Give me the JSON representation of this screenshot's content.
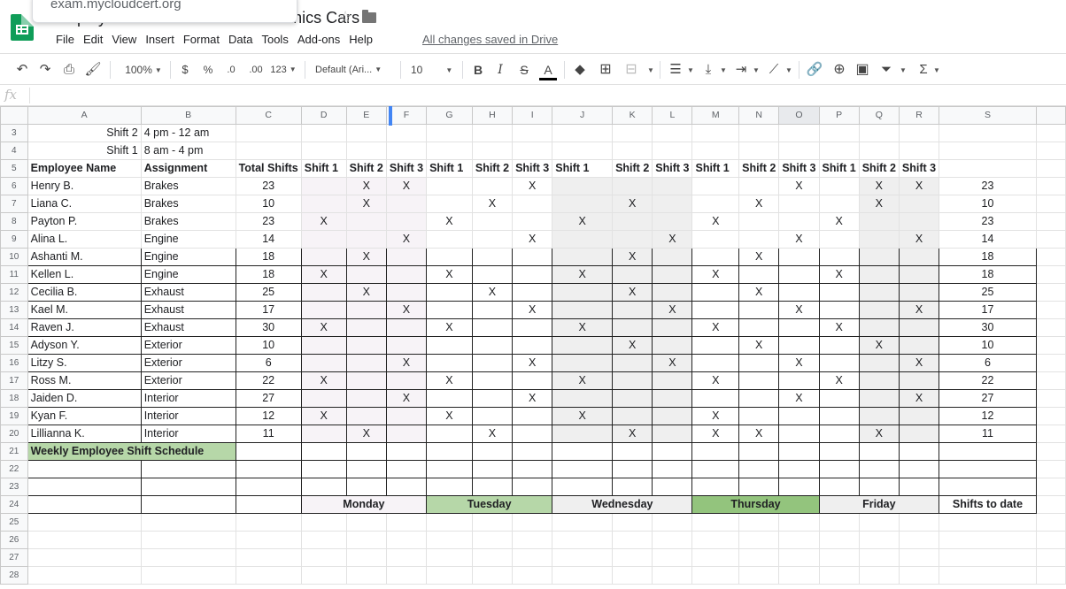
{
  "header": {
    "doc_title": "Employee Shift Schedule - Mechanics Cars",
    "url_overlay": "exam.mycloudcert.org",
    "menu": [
      "File",
      "Edit",
      "View",
      "Insert",
      "Format",
      "Data",
      "Tools",
      "Add-ons",
      "Help"
    ],
    "save_status": "All changes saved in Drive"
  },
  "toolbar": {
    "zoom": "100%",
    "currency": "$",
    "percent": "%",
    "dec_decrease": ".0",
    "dec_increase": ".00",
    "more_formats": "123",
    "font": "Default (Ari...",
    "font_size": "10",
    "bold": "B",
    "italic": "I",
    "strike": "S",
    "text_color": "A",
    "sum": "Σ"
  },
  "formula_bar": {
    "fx_label": "fx",
    "value": ""
  },
  "columns": [
    "A",
    "B",
    "C",
    "D",
    "E",
    "F",
    "G",
    "H",
    "I",
    "J",
    "K",
    "L",
    "M",
    "N",
    "O",
    "P",
    "Q",
    "R",
    "S"
  ],
  "sheet": {
    "shift2_label": "Shift 2",
    "shift2_time": "4 pm - 12 am",
    "shift1_label": "Shift 1",
    "shift1_time": "8 am - 4 pm",
    "headers": {
      "employee": "Employee Name",
      "assignment": "Assignment",
      "total": "Total Shifts",
      "shifts": [
        "Shift 1",
        "Shift 2",
        "Shift 3",
        "Shift 1",
        "Shift 2",
        "Shift 3",
        "Shift 1",
        "Shift 2",
        "Shift 3",
        "Shift 1",
        "Shift 2",
        "Shift 3",
        "Shift 1",
        "Shift 2",
        "Shift 3"
      ]
    },
    "mark": "X",
    "employees": [
      {
        "row": "6",
        "name": "Henry B.",
        "assignment": "Brakes",
        "total": "23",
        "marks": [
          0,
          1,
          1,
          0,
          0,
          1,
          0,
          0,
          0,
          0,
          0,
          1,
          0,
          1,
          1
        ],
        "to_date": "23"
      },
      {
        "row": "7",
        "name": "Liana C.",
        "assignment": "Brakes",
        "total": "10",
        "marks": [
          0,
          1,
          0,
          0,
          1,
          0,
          0,
          1,
          0,
          0,
          1,
          0,
          0,
          1,
          0
        ],
        "to_date": "10"
      },
      {
        "row": "8",
        "name": "Payton P.",
        "assignment": "Brakes",
        "total": "23",
        "marks": [
          1,
          0,
          0,
          1,
          0,
          0,
          1,
          0,
          0,
          1,
          0,
          0,
          1,
          0,
          0
        ],
        "to_date": "23"
      },
      {
        "row": "9",
        "name": "Alina L.",
        "assignment": "Engine",
        "total": "14",
        "marks": [
          0,
          0,
          1,
          0,
          0,
          1,
          0,
          0,
          1,
          0,
          0,
          1,
          0,
          0,
          1
        ],
        "to_date": "14"
      },
      {
        "row": "10",
        "name": "Ashanti M.",
        "assignment": "Engine",
        "total": "18",
        "marks": [
          0,
          1,
          0,
          0,
          0,
          0,
          0,
          1,
          0,
          0,
          1,
          0,
          0,
          0,
          0
        ],
        "to_date": "18"
      },
      {
        "row": "11",
        "name": "Kellen L.",
        "assignment": "Engine",
        "total": "18",
        "marks": [
          1,
          0,
          0,
          1,
          0,
          0,
          1,
          0,
          0,
          1,
          0,
          0,
          1,
          0,
          0
        ],
        "to_date": "18"
      },
      {
        "row": "12",
        "name": "Cecilia B.",
        "assignment": "Exhaust",
        "total": "25",
        "marks": [
          0,
          1,
          0,
          0,
          1,
          0,
          0,
          1,
          0,
          0,
          1,
          0,
          0,
          0,
          0
        ],
        "to_date": "25"
      },
      {
        "row": "13",
        "name": "Kael M.",
        "assignment": "Exhaust",
        "total": "17",
        "marks": [
          0,
          0,
          1,
          0,
          0,
          1,
          0,
          0,
          1,
          0,
          0,
          1,
          0,
          0,
          1
        ],
        "to_date": "17"
      },
      {
        "row": "14",
        "name": "Raven J.",
        "assignment": "Exhaust",
        "total": "30",
        "marks": [
          1,
          0,
          0,
          1,
          0,
          0,
          1,
          0,
          0,
          1,
          0,
          0,
          1,
          0,
          0
        ],
        "to_date": "30"
      },
      {
        "row": "15",
        "name": "Adyson Y.",
        "assignment": "Exterior",
        "total": "10",
        "marks": [
          0,
          0,
          0,
          0,
          0,
          0,
          0,
          1,
          0,
          0,
          1,
          0,
          0,
          1,
          0
        ],
        "to_date": "10"
      },
      {
        "row": "16",
        "name": "Litzy S.",
        "assignment": "Exterior",
        "total": "6",
        "marks": [
          0,
          0,
          1,
          0,
          0,
          1,
          0,
          0,
          1,
          0,
          0,
          1,
          0,
          0,
          1
        ],
        "to_date": "6"
      },
      {
        "row": "17",
        "name": "Ross M.",
        "assignment": "Exterior",
        "total": "22",
        "marks": [
          1,
          0,
          0,
          1,
          0,
          0,
          1,
          0,
          0,
          1,
          0,
          0,
          1,
          0,
          0
        ],
        "to_date": "22"
      },
      {
        "row": "18",
        "name": "Jaiden D.",
        "assignment": "Interior",
        "total": "27",
        "marks": [
          0,
          0,
          1,
          0,
          0,
          1,
          0,
          0,
          0,
          0,
          0,
          1,
          0,
          0,
          1
        ],
        "to_date": "27"
      },
      {
        "row": "19",
        "name": "Kyan F.",
        "assignment": "Interior",
        "total": "12",
        "marks": [
          1,
          0,
          0,
          1,
          0,
          0,
          1,
          0,
          0,
          1,
          0,
          0,
          0,
          0,
          0
        ],
        "to_date": "12"
      },
      {
        "row": "20",
        "name": "Lillianna K.",
        "assignment": "Interior",
        "total": "11",
        "marks": [
          0,
          1,
          0,
          0,
          1,
          0,
          0,
          1,
          0,
          1,
          1,
          0,
          0,
          1,
          0
        ],
        "to_date": "11"
      }
    ],
    "schedule_title": "Weekly Employee Shift Schedule",
    "days": [
      "Monday",
      "Tuesday",
      "Wednesday",
      "Thursday",
      "Friday"
    ],
    "shifts_to_date": "Shifts to date"
  },
  "colors": {
    "sheets_green": "#0f9d58",
    "tuesday_fill": "#b6d7a8",
    "thursday_fill": "#93c47d",
    "wednesday_fill": "#efefef",
    "monday_fill": "#f7f3f7",
    "selection_blue": "#4285f4"
  }
}
